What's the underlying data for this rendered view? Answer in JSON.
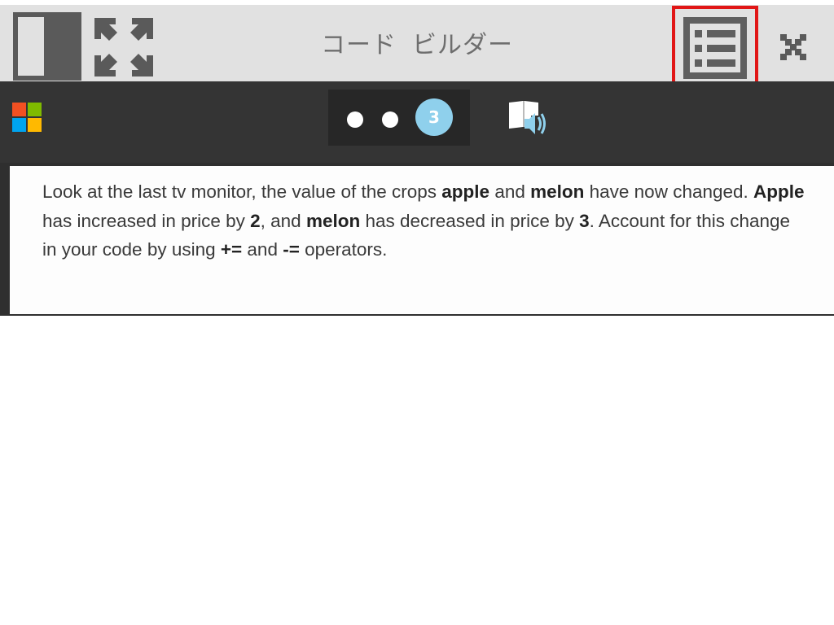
{
  "window": {
    "title": "コード ビルダー"
  },
  "titlebar": {
    "split_view_icon": "split-view-icon",
    "expand_icon": "expand-arrows-icon",
    "list_icon": "list-icon",
    "close_icon": "close-icon",
    "highlight_color": "#e11616"
  },
  "toolbar": {
    "logo_icon": "microsoft-logo-icon",
    "logo_colors": [
      "#f25022",
      "#7fba00",
      "#00a4ef",
      "#ffb900"
    ],
    "steps": {
      "count": 3,
      "current_label": "3",
      "active_color": "#8fd0ec"
    },
    "audio_icon": "immersive-reader-audio-icon"
  },
  "content": {
    "segments": [
      {
        "text": "Look at the last tv monitor, the value of the crops ",
        "bold": false
      },
      {
        "text": "apple",
        "bold": true
      },
      {
        "text": " and ",
        "bold": false
      },
      {
        "text": "melon",
        "bold": true
      },
      {
        "text": " have now changed. ",
        "bold": false
      },
      {
        "text": "Apple",
        "bold": true
      },
      {
        "text": " has increased in price by ",
        "bold": false
      },
      {
        "text": "2",
        "bold": true
      },
      {
        "text": ", and ",
        "bold": false
      },
      {
        "text": "melon",
        "bold": true
      },
      {
        "text": " has decreased in price by ",
        "bold": false
      },
      {
        "text": "3",
        "bold": true
      },
      {
        "text": ". Account for this change in your code by using ",
        "bold": false
      },
      {
        "text": "+=",
        "bold": true
      },
      {
        "text": " and ",
        "bold": false
      },
      {
        "text": "-=",
        "bold": true
      },
      {
        "text": " operators.",
        "bold": false
      }
    ]
  }
}
